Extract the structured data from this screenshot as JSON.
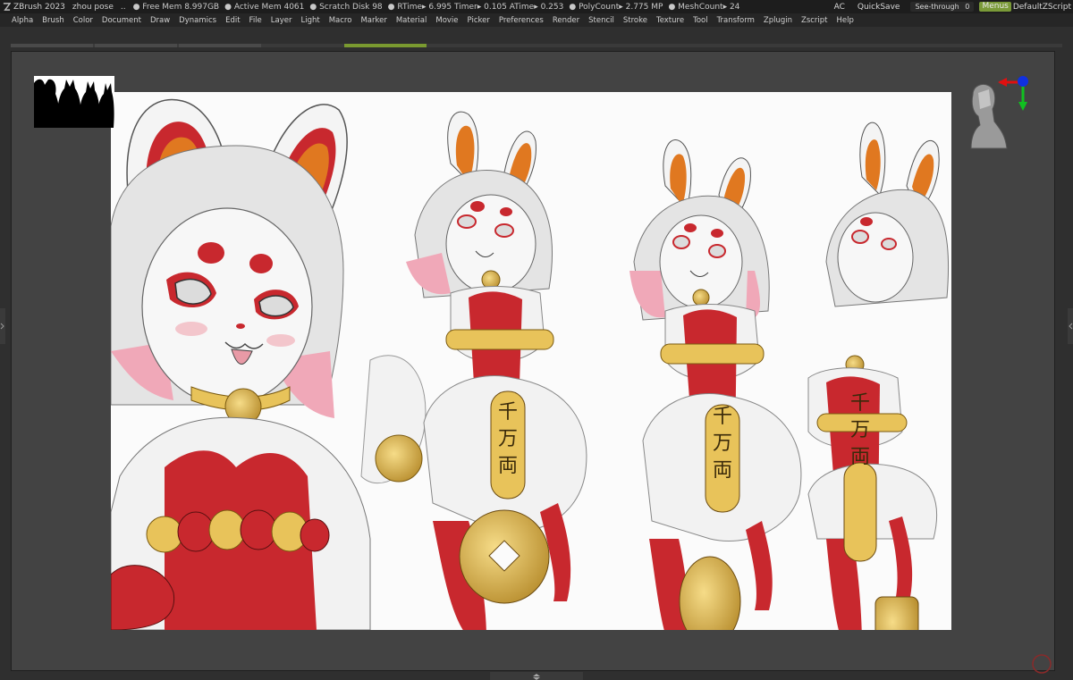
{
  "titlebar": {
    "app": "ZBrush 2023",
    "project": "zhou pose",
    "ellipsis": "..",
    "stats": [
      "● Free Mem 8.997GB",
      "● Active Mem 4061",
      "● Scratch Disk 98",
      "● RTime▸ 6.995 Timer▸ 0.105 ATime▸ 0.253",
      "● PolyCount▸ 2.775 MP",
      "● MeshCount▸ 24"
    ],
    "ac": "AC",
    "quicksave": "QuickSave",
    "seethrough_label": "See-through",
    "seethrough_value": "0",
    "seethrough_level": 0,
    "menus": "Menus",
    "script": "DefaultZScript"
  },
  "menu": [
    "Alpha",
    "Brush",
    "Color",
    "Document",
    "Draw",
    "Dynamics",
    "Edit",
    "File",
    "Layer",
    "Light",
    "Macro",
    "Marker",
    "Material",
    "Movie",
    "Picker",
    "Preferences",
    "Render",
    "Stencil",
    "Stroke",
    "Texture",
    "Tool",
    "Transform",
    "Zplugin",
    "Zscript",
    "Help"
  ],
  "canvas": {
    "mug_characters": [
      "千",
      "万",
      "両"
    ]
  },
  "colors": {
    "accent": "#7a9a30",
    "fur": "#f2f2f2",
    "red": "#c8282e",
    "gold": "#e8c35a",
    "ear_orange": "#e07820",
    "hair_pink": "#f0a8b8"
  },
  "icons": {
    "logo": "zbrush-logo-icon",
    "navigator": "head-navigator-icon",
    "axis": "axis-gizmo-icon"
  }
}
